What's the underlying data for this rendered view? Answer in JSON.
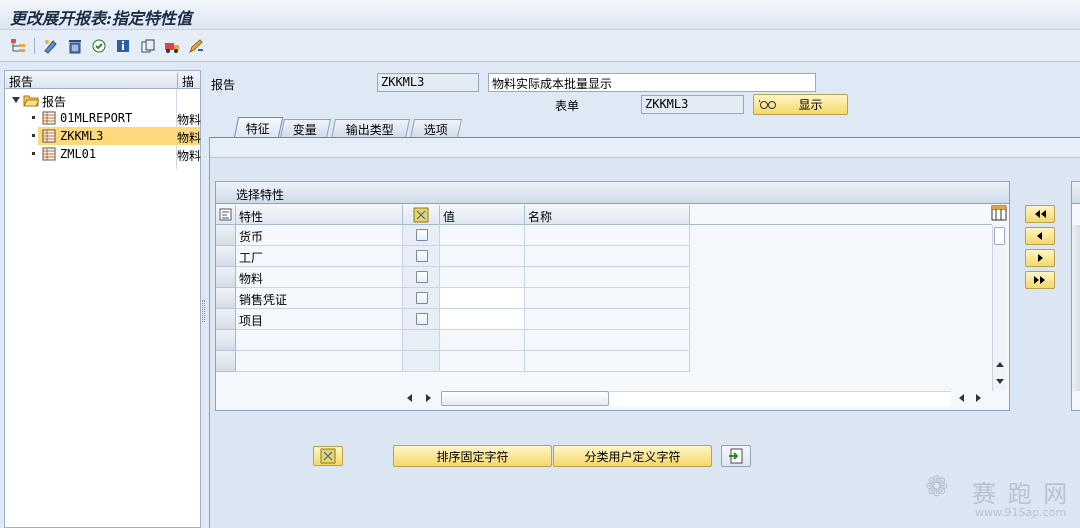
{
  "window": {
    "title": "更改展开报表:指定特性值"
  },
  "toolbar": {
    "icons": [
      "hierarchy-icon",
      "change-icon",
      "delete-icon",
      "check-icon",
      "info-icon",
      "copy-icon",
      "transport-icon",
      "edit-icon"
    ]
  },
  "tree": {
    "header_col1": "报告",
    "header_col2": "描",
    "root": {
      "label": "报告"
    },
    "items": [
      {
        "label": "01MLREPORT",
        "desc": "物料"
      },
      {
        "label": "ZKKML3",
        "desc": "物料",
        "selected": true
      },
      {
        "label": "ZML01",
        "desc": "物料"
      }
    ]
  },
  "header": {
    "report_label": "报告",
    "report_value": "ZKKML3",
    "report_desc": "物料实际成本批量显示",
    "form_label": "表单",
    "form_value": "ZKKML3",
    "display_button": "显示"
  },
  "tabs": [
    {
      "label": "特征",
      "active": true
    },
    {
      "label": "变量",
      "active": false
    },
    {
      "label": "输出类型",
      "active": false
    },
    {
      "label": "选项",
      "active": false
    }
  ],
  "table": {
    "title": "选择特性",
    "columns": [
      "特性",
      "",
      "值",
      "名称"
    ],
    "rows": [
      {
        "feature": "货币",
        "checked": false,
        "value": "",
        "name": "",
        "editable": false
      },
      {
        "feature": "工厂",
        "checked": false,
        "value": "",
        "name": "",
        "editable": false
      },
      {
        "feature": "物料",
        "checked": false,
        "value": "",
        "name": "",
        "editable": false
      },
      {
        "feature": "销售凭证",
        "checked": false,
        "value": "",
        "name": "",
        "editable": true
      },
      {
        "feature": "项目",
        "checked": false,
        "value": "",
        "name": "",
        "editable": true
      },
      {
        "feature": "",
        "checked": null,
        "value": "",
        "name": "",
        "editable": false
      },
      {
        "feature": "",
        "checked": null,
        "value": "",
        "name": "",
        "editable": false
      },
      {
        "feature": "",
        "checked": null,
        "value": "",
        "name": "",
        "editable": false
      }
    ]
  },
  "buttons": {
    "sort_fixed": "排序固定字符",
    "classify_user": "分类用户定义字符"
  },
  "watermark": {
    "text": "赛 跑 网",
    "url": "www.91Sap.com"
  },
  "colors": {
    "selection": "#fbd97c",
    "button": "#f4d868",
    "background": "#dfe9f5"
  }
}
